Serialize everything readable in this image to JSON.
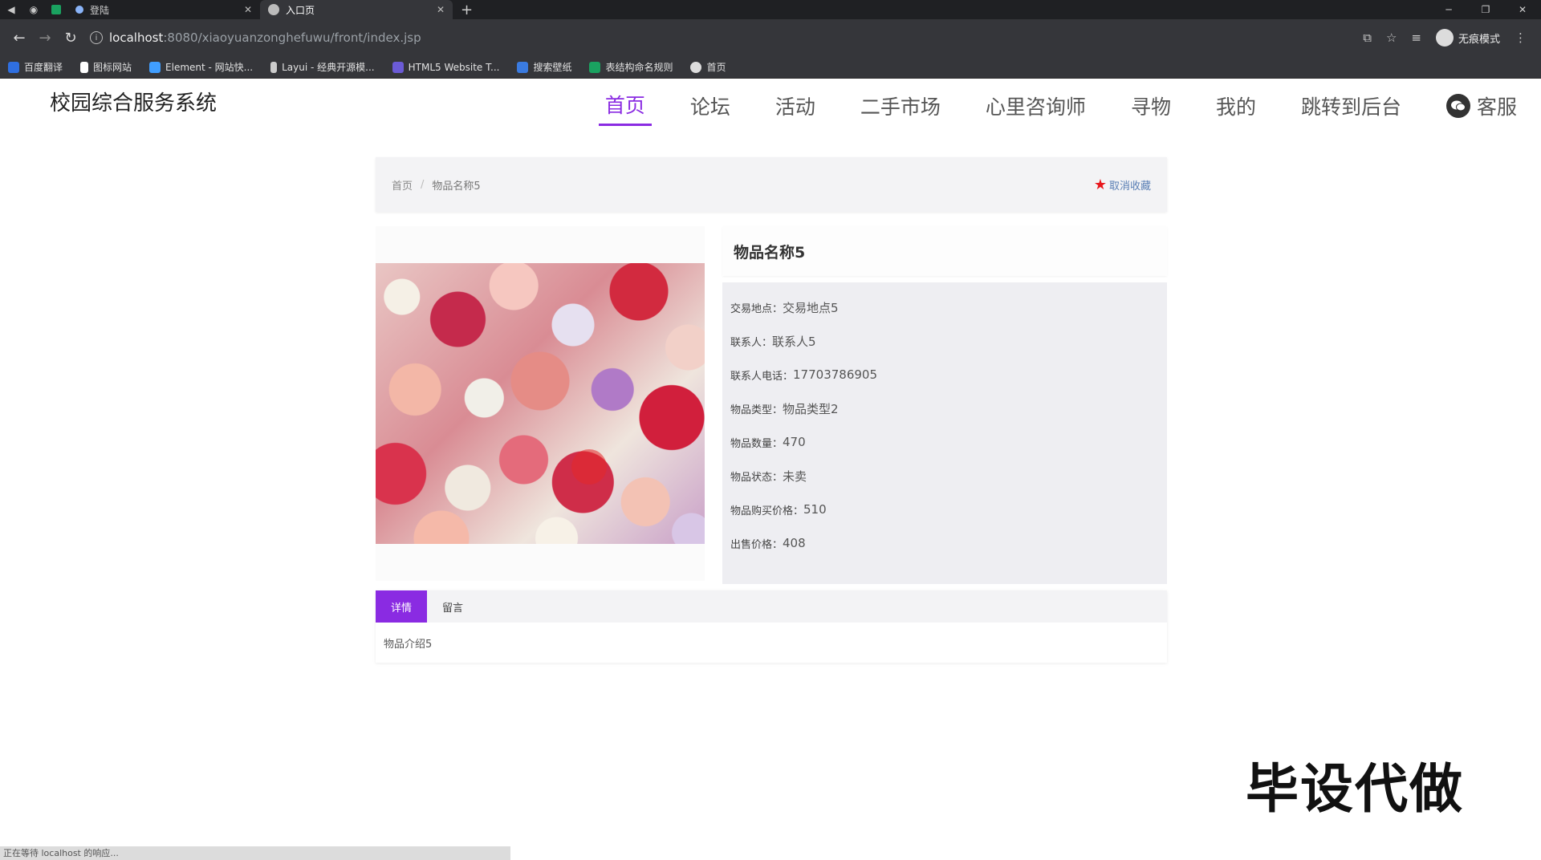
{
  "browser": {
    "tabs": [
      {
        "title": "登陆"
      },
      {
        "title": "入口页"
      }
    ],
    "url_host": "localhost",
    "url_path": ":8080/xiaoyuanzonghefuwu/front/index.jsp",
    "profile_label": "无痕模式",
    "bookmarks": [
      {
        "label": "百度翻译",
        "color": "#2f6fe0"
      },
      {
        "label": "图标网站",
        "color": "#ffffff"
      },
      {
        "label": "Element - 网站快...",
        "color": "#409eff"
      },
      {
        "label": "Layui - 经典开源模...",
        "color": "#ffffff"
      },
      {
        "label": "HTML5 Website T...",
        "color": "#6b5bd6"
      },
      {
        "label": "搜索壁纸",
        "color": "#3a7be0"
      },
      {
        "label": "表结构命名规则",
        "color": "#1aa260"
      },
      {
        "label": "首页",
        "color": "#dddddd"
      }
    ],
    "status_text": "正在等待 localhost 的响应..."
  },
  "site": {
    "title": "校园综合服务系统",
    "nav": [
      "首页",
      "论坛",
      "活动",
      "二手市场",
      "心里咨询师",
      "寻物",
      "我的",
      "跳转到后台",
      "客服"
    ],
    "active_nav": "首页",
    "accent_color": "#8a2be2"
  },
  "breadcrumb": {
    "home": "首页",
    "separator": "/",
    "current": "物品名称5"
  },
  "favorite_label": "取消收藏",
  "item": {
    "name": "物品名称5",
    "fields": [
      {
        "label": "交易地点：",
        "value": "交易地点5"
      },
      {
        "label": "联系人：",
        "value": "联系人5"
      },
      {
        "label": "联系人电话：",
        "value": "17703786905"
      },
      {
        "label": "物品类型：",
        "value": "物品类型2"
      },
      {
        "label": "物品数量：",
        "value": "470"
      },
      {
        "label": "物品状态：",
        "value": "未卖"
      },
      {
        "label": "物品购买价格：",
        "value": "510"
      },
      {
        "label": "出售价格：",
        "value": "408"
      }
    ]
  },
  "detail_tabs": {
    "tabs": [
      "详情",
      "留言"
    ],
    "active": "详情",
    "content": "物品介绍5"
  },
  "watermark": "毕设代做"
}
